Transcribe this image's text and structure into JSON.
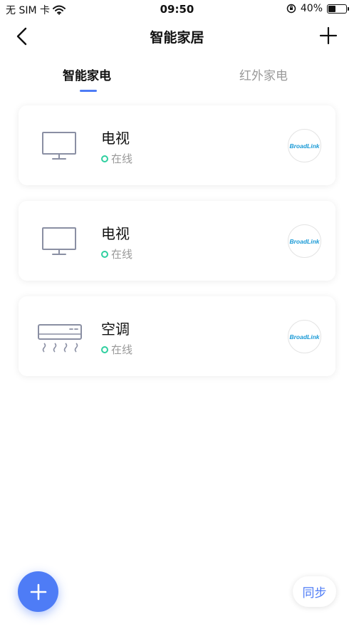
{
  "status_bar": {
    "carrier": "无 SIM 卡",
    "time": "09:50",
    "battery_percent": "40%",
    "battery_level": 0.4,
    "icons": [
      "wifi-icon",
      "orientation-lock-icon",
      "battery-icon"
    ]
  },
  "nav": {
    "title": "智能家居",
    "back_icon": "chevron-left-icon",
    "add_icon": "plus-icon"
  },
  "tabs": [
    {
      "label": "智能家电",
      "active": true
    },
    {
      "label": "红外家电",
      "active": false
    }
  ],
  "devices": [
    {
      "name": "电视",
      "status": "在线",
      "icon": "tv-icon",
      "brand": "BroadLink"
    },
    {
      "name": "电视",
      "status": "在线",
      "icon": "tv-icon",
      "brand": "BroadLink"
    },
    {
      "name": "空调",
      "status": "在线",
      "icon": "air-conditioner-icon",
      "brand": "BroadLink"
    }
  ],
  "actions": {
    "fab_icon": "plus-icon",
    "sync_label": "同步"
  },
  "colors": {
    "accent": "#4e7cf6",
    "online": "#2ecf9f",
    "brand": "#1a9ad6",
    "muted_text": "#999999"
  }
}
